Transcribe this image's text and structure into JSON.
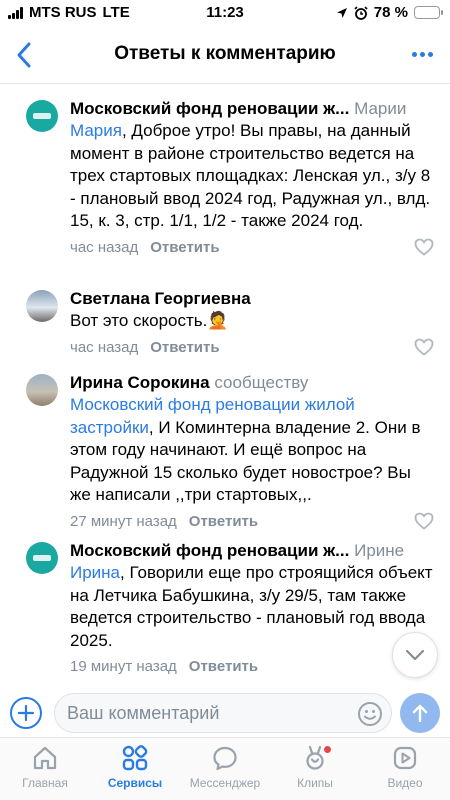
{
  "status_bar": {
    "carrier": "MTS RUS",
    "network": "LTE",
    "time": "11:23",
    "battery_text": "78 %",
    "battery_level": 0.78
  },
  "header": {
    "title": "Ответы к комментарию"
  },
  "comments": [
    {
      "author": "Московский фонд реновации ж...",
      "addressee": "Марии",
      "mention": "Мария",
      "text": ", Доброе утро! Вы правы, на данный момент в районе строительство ведется на трех стартовых площадках: Ленская ул., з/у 8 - плановый ввод 2024 год, Радужная ул., влд. 15, к. 3, стр. 1/1, 1/2 - также 2024 год.",
      "time": "час назад",
      "reply_label": "Ответить"
    },
    {
      "author": "Светлана Георгиевна",
      "text": "Вот это скорость.🤦",
      "time": "час назад",
      "reply_label": "Ответить"
    },
    {
      "author": "Ирина Сорокина",
      "addressee": "сообществу",
      "mention": "Московский фонд реновации жилой застройки",
      "text": ", И Коминтерна владение 2. Они в этом году начинают. И ещё вопрос  на Радужной 15 сколько будет новострое? Вы же написали ,,три стартовых,,.",
      "time": "27 минут назад",
      "reply_label": "Ответить"
    },
    {
      "author": "Московский фонд реновации ж...",
      "addressee": "Ирине",
      "mention": "Ирина",
      "text": ", Говорили еще про строящийся объект на Летчика Бабушкина, з/у 29/5, там также ведется строительство - плановый год ввода 2025.",
      "time": "19 минут назад",
      "reply_label": "Ответить"
    }
  ],
  "compose": {
    "placeholder": "Ваш комментарий"
  },
  "tabbar": [
    {
      "label": "Главная",
      "icon": "home-icon",
      "active": false
    },
    {
      "label": "Сервисы",
      "icon": "services-icon",
      "active": true
    },
    {
      "label": "Мессенджер",
      "icon": "messenger-icon",
      "active": false
    },
    {
      "label": "Клипы",
      "icon": "clips-icon",
      "active": false,
      "badge": true
    },
    {
      "label": "Видео",
      "icon": "video-icon",
      "active": false
    }
  ],
  "colors": {
    "accent": "#2a7be4",
    "muted": "#818c99",
    "fund_avatar": "#1aa9a1",
    "badge": "#e64646"
  }
}
